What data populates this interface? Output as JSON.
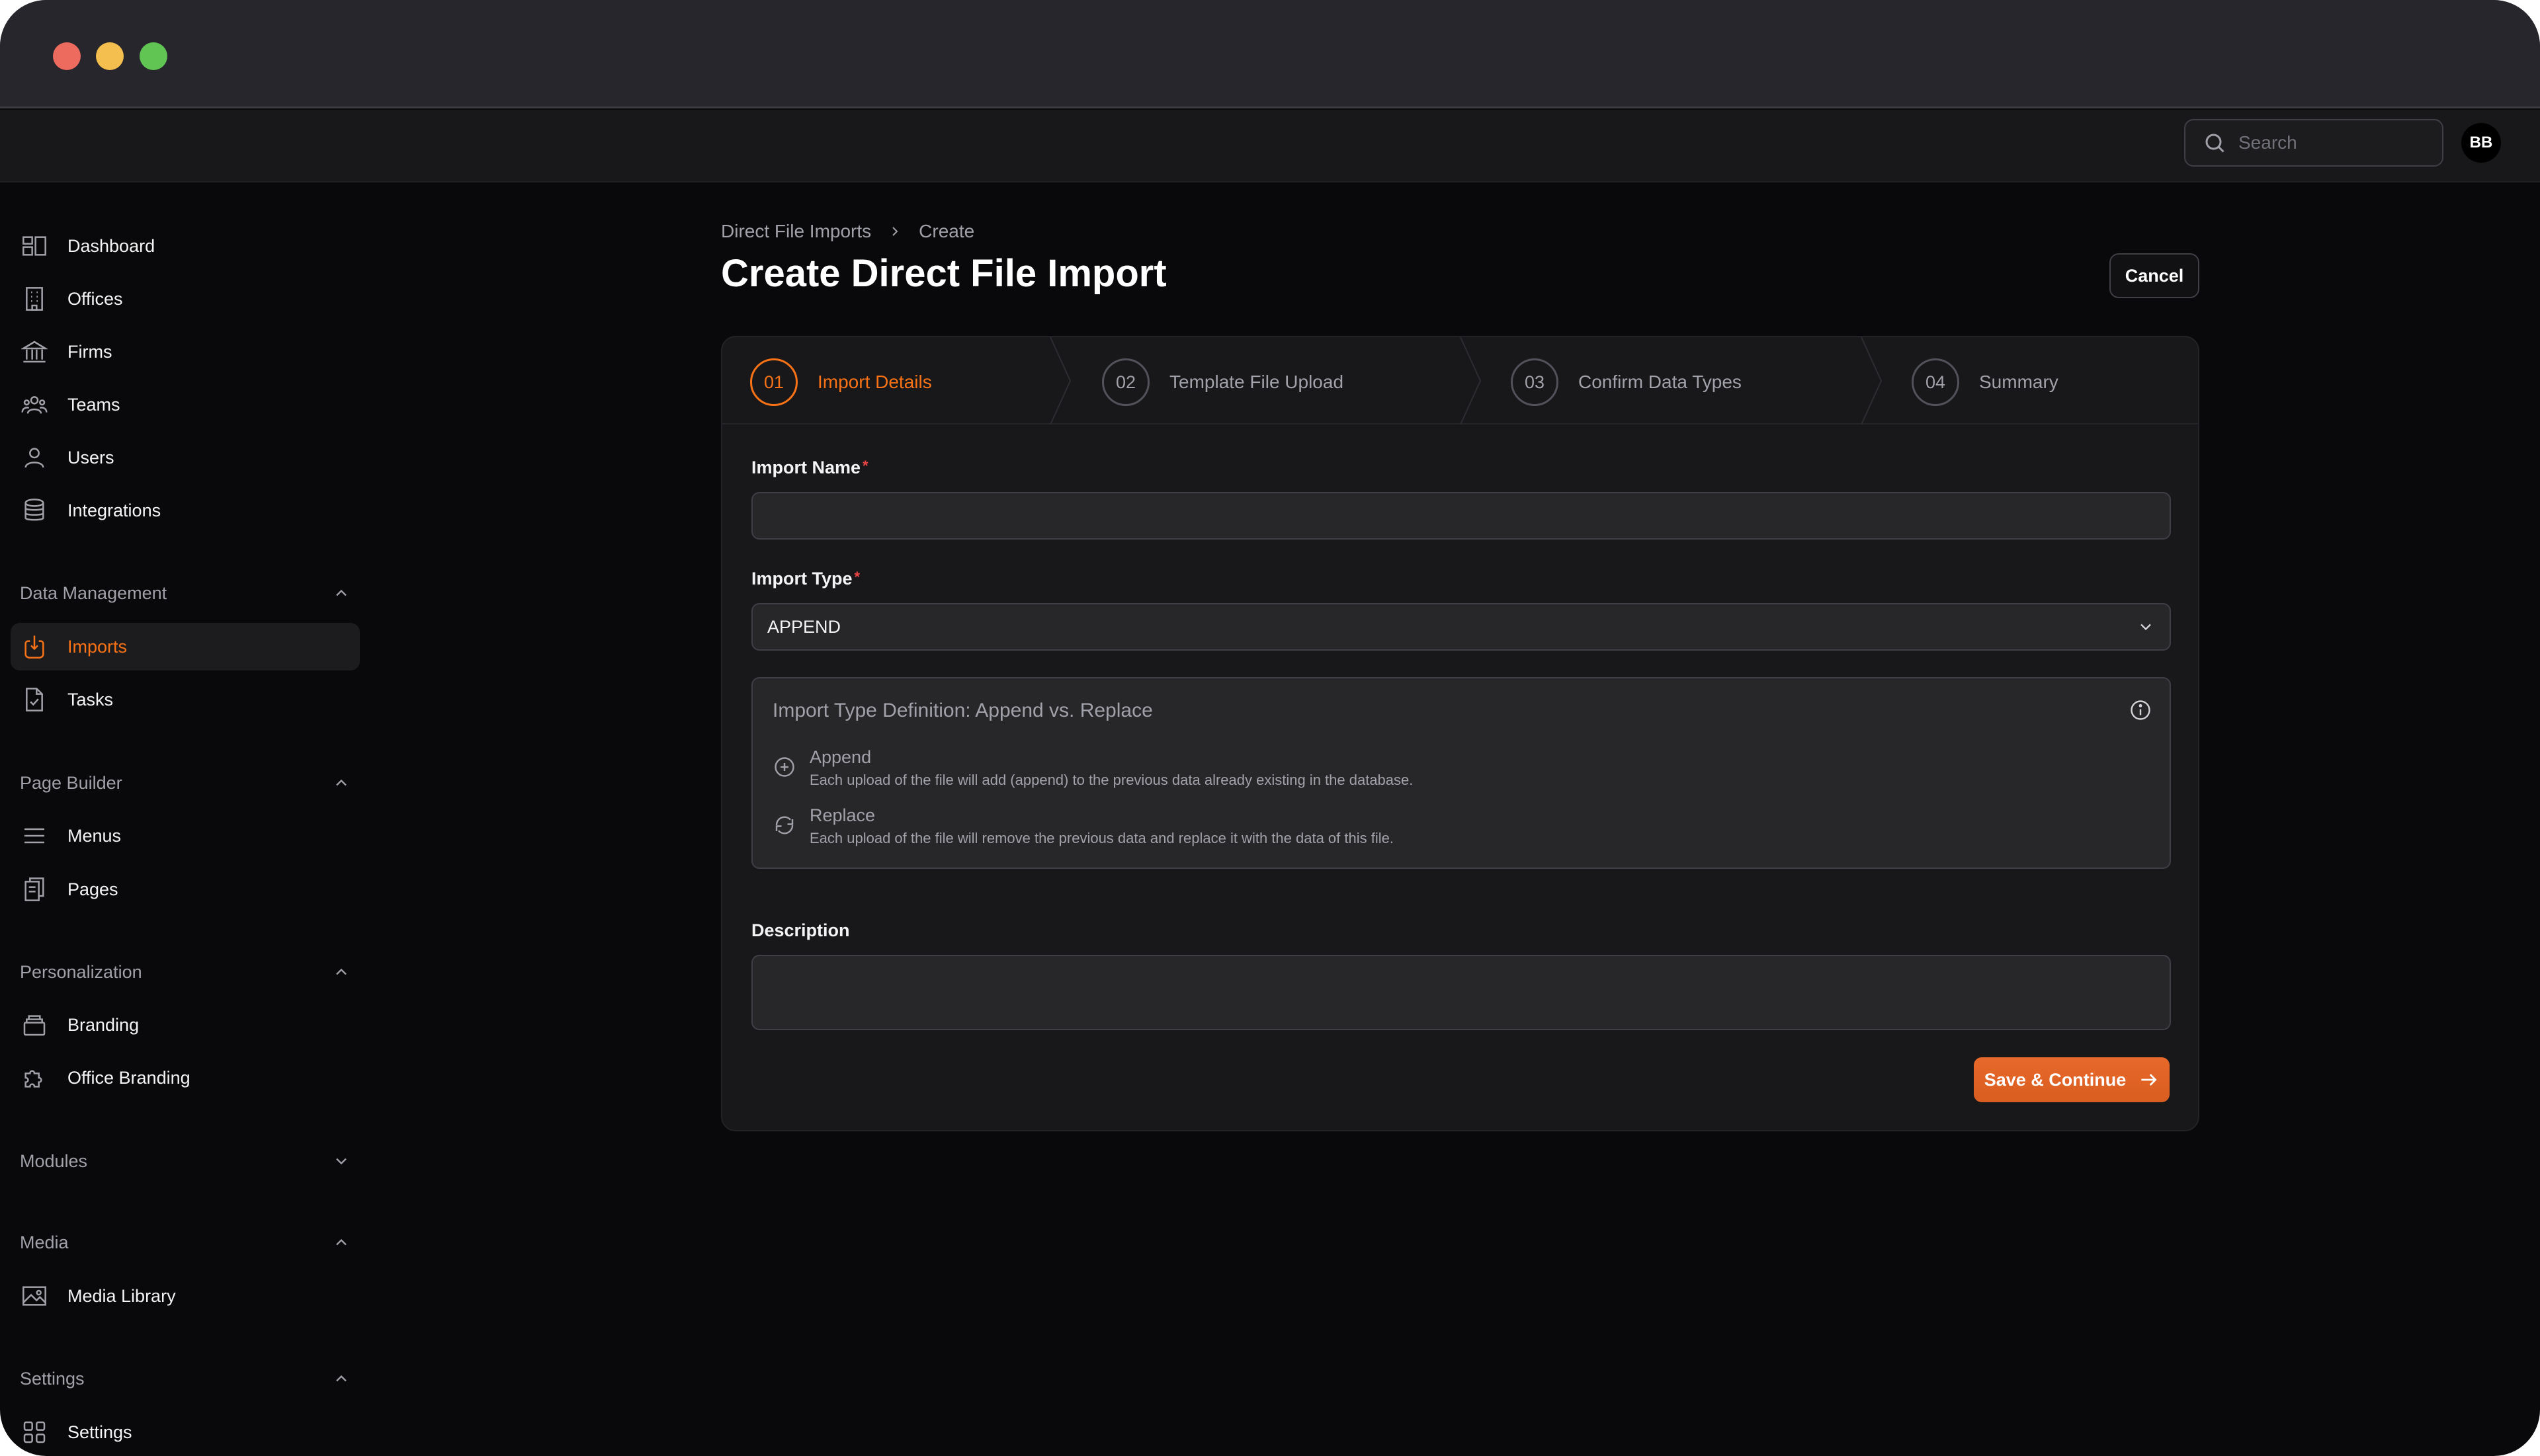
{
  "search": {
    "placeholder": "Search"
  },
  "user": {
    "initials": "BB"
  },
  "sidebar": {
    "top_items": [
      {
        "label": "Dashboard",
        "icon": "dashboard-icon"
      },
      {
        "label": "Offices",
        "icon": "building-icon"
      },
      {
        "label": "Firms",
        "icon": "bank-icon"
      },
      {
        "label": "Teams",
        "icon": "teams-icon"
      },
      {
        "label": "Users",
        "icon": "user-icon"
      },
      {
        "label": "Integrations",
        "icon": "database-icon"
      }
    ],
    "sections": {
      "data_management": {
        "label": "Data Management",
        "items": [
          {
            "label": "Imports",
            "icon": "import-icon",
            "active": true
          },
          {
            "label": "Tasks",
            "icon": "task-file-icon"
          }
        ]
      },
      "page_builder": {
        "label": "Page Builder",
        "items": [
          {
            "label": "Menus",
            "icon": "menu-icon"
          },
          {
            "label": "Pages",
            "icon": "pages-icon"
          }
        ]
      },
      "personalization": {
        "label": "Personalization",
        "items": [
          {
            "label": "Branding",
            "icon": "layers-icon"
          },
          {
            "label": "Office Branding",
            "icon": "puzzle-icon"
          }
        ]
      },
      "modules": {
        "label": "Modules"
      },
      "media": {
        "label": "Media",
        "items": [
          {
            "label": "Media Library",
            "icon": "image-icon"
          }
        ]
      },
      "settings": {
        "label": "Settings",
        "items": [
          {
            "label": "Settings",
            "icon": "grid-icon"
          }
        ]
      }
    }
  },
  "breadcrumb": {
    "parent": "Direct File Imports",
    "current": "Create"
  },
  "page": {
    "title": "Create Direct File Import",
    "cancel_label": "Cancel"
  },
  "steps": [
    {
      "number": "01",
      "label": "Import Details",
      "active": true
    },
    {
      "number": "02",
      "label": "Template File Upload"
    },
    {
      "number": "03",
      "label": "Confirm Data Types"
    },
    {
      "number": "04",
      "label": "Summary"
    }
  ],
  "form": {
    "import_name": {
      "label": "Import Name",
      "required_mark": "*",
      "value": ""
    },
    "import_type": {
      "label": "Import Type",
      "required_mark": "*",
      "value": "APPEND"
    },
    "definition": {
      "title": "Import Type Definition: Append vs. Replace",
      "append": {
        "name": "Append",
        "description": "Each upload of the file will add (append) to the previous data already existing in the database."
      },
      "replace": {
        "name": "Replace",
        "description": "Each upload of the file will remove the previous data and replace it with the data of this file."
      }
    },
    "description": {
      "label": "Description",
      "value": ""
    },
    "save_label": "Save & Continue"
  },
  "colors": {
    "accent": "#f97316",
    "background": "#09090b",
    "card": "#18181b"
  }
}
